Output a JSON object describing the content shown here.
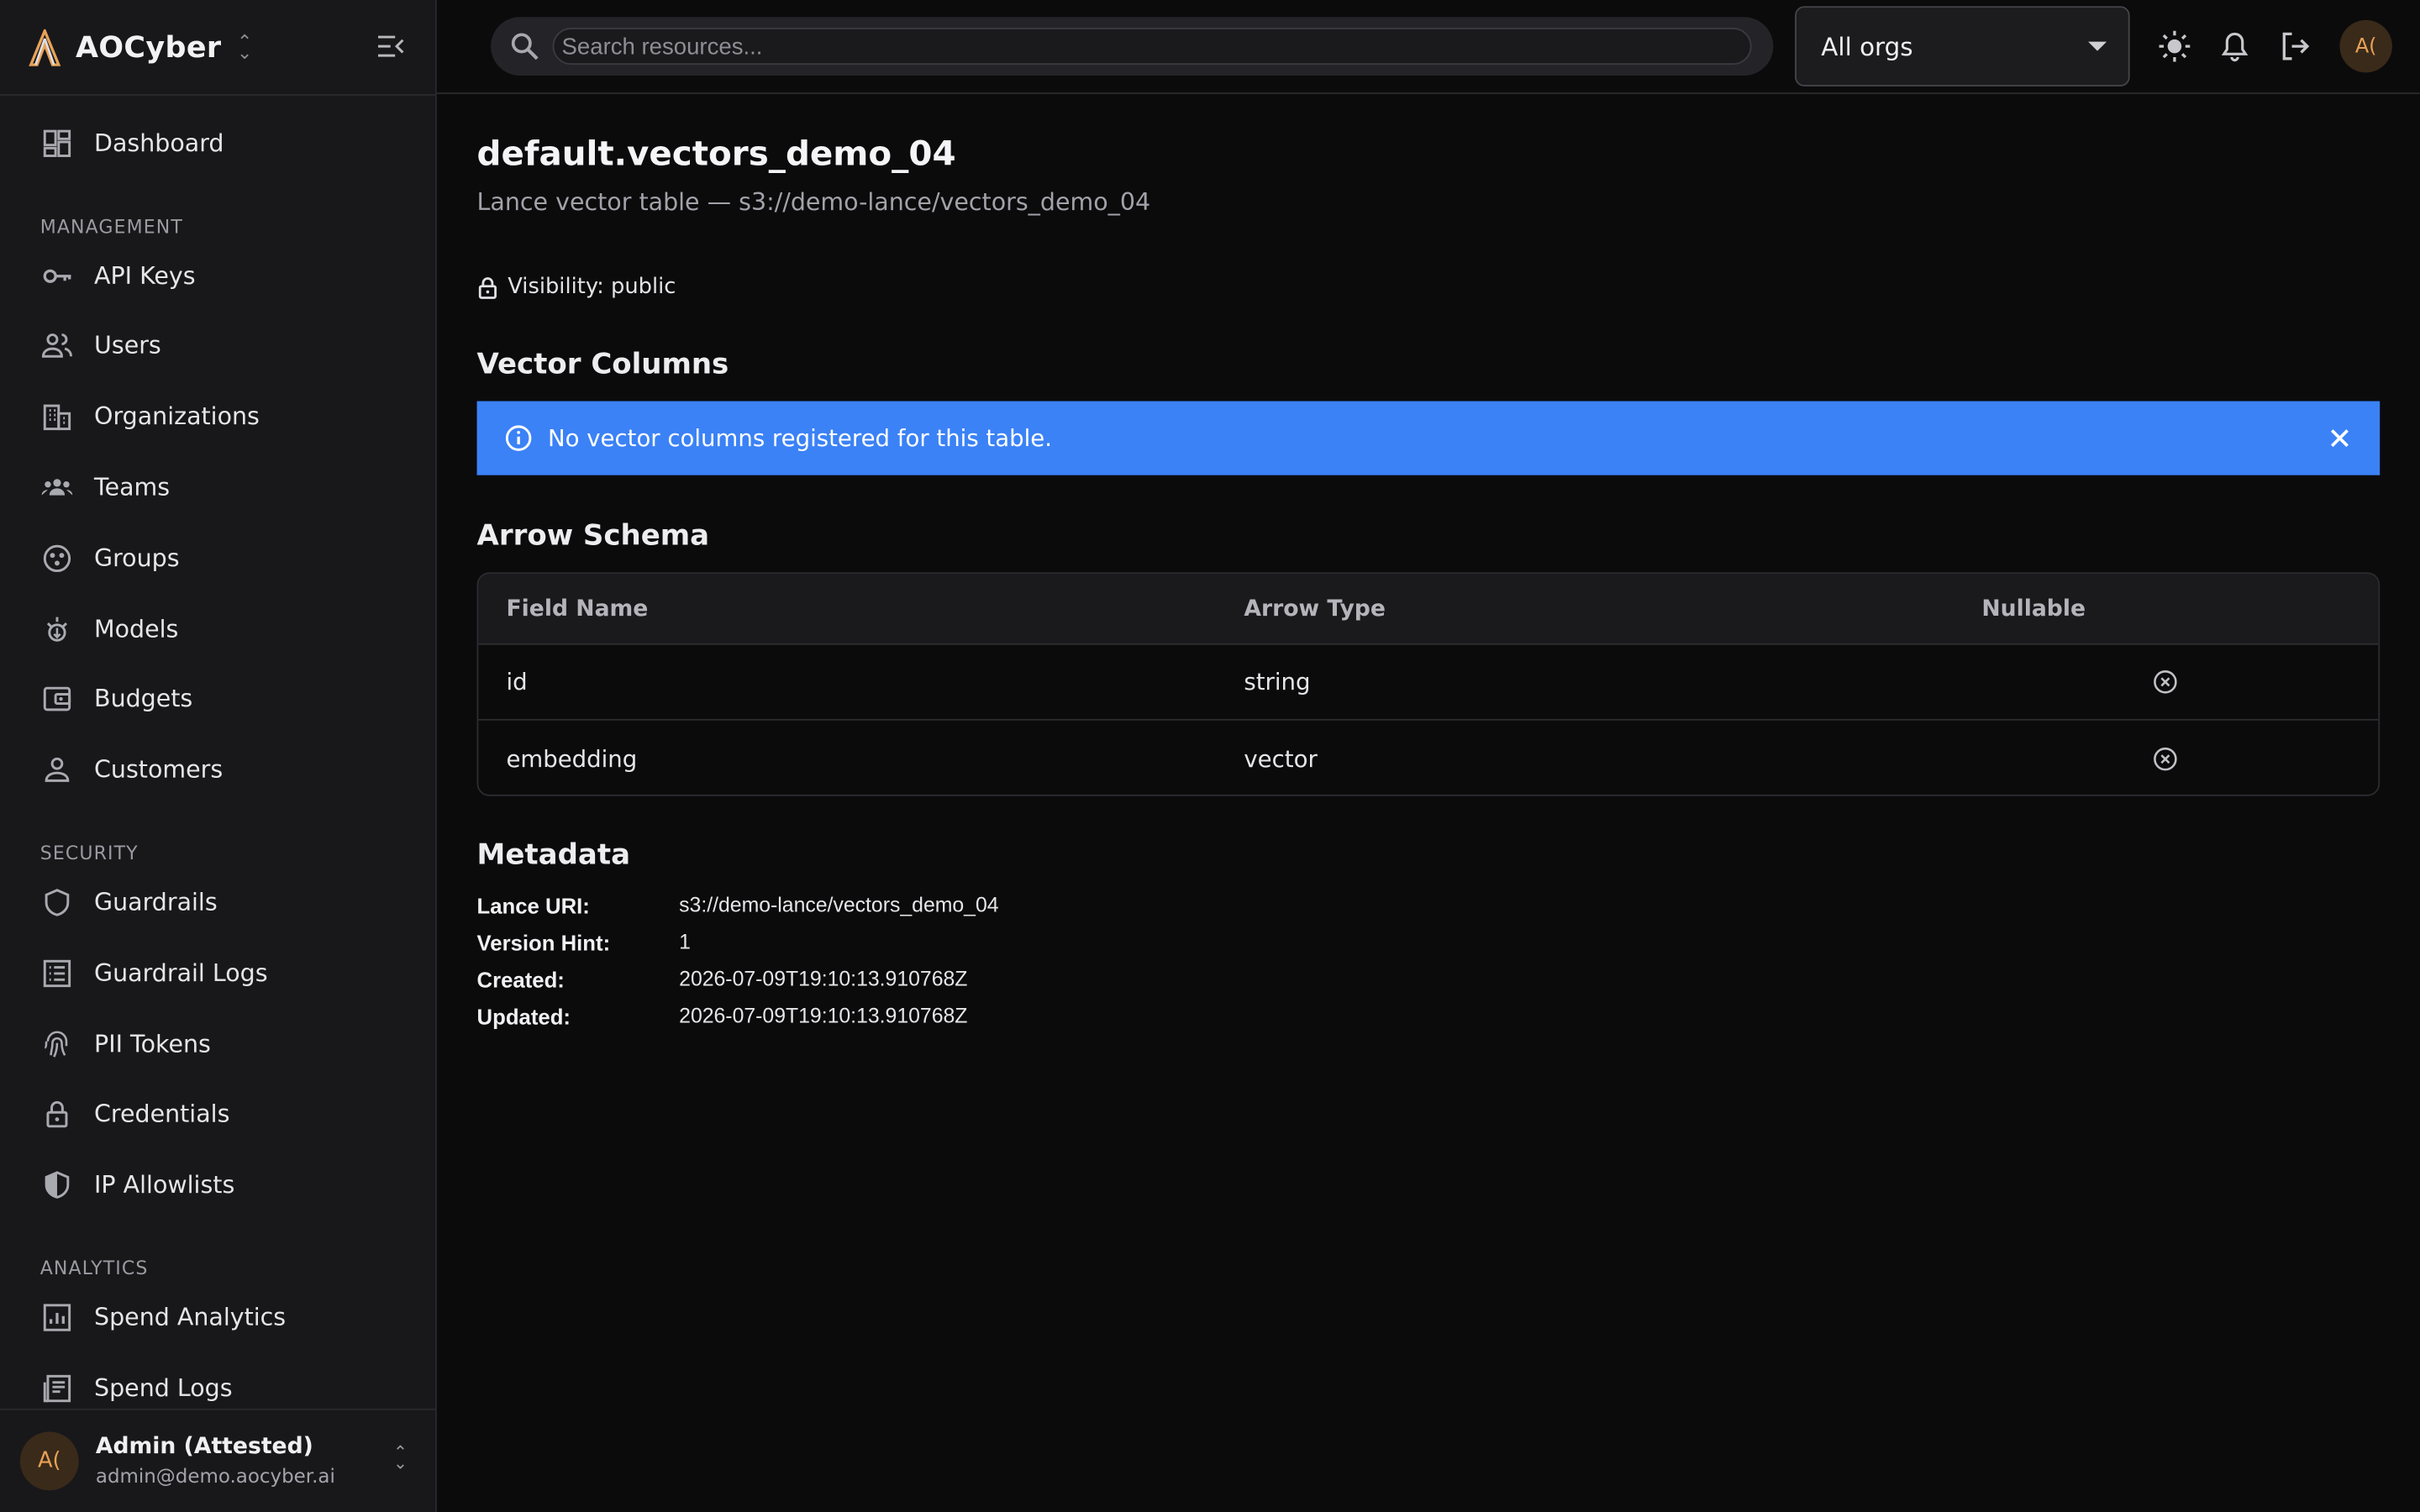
{
  "app": {
    "name": "AOCyber"
  },
  "sidebar": {
    "top_items": [
      {
        "label": "Dashboard",
        "icon": "dashboard-icon"
      }
    ],
    "sections": [
      {
        "title": "MANAGEMENT",
        "items": [
          {
            "label": "API Keys",
            "icon": "key-icon"
          },
          {
            "label": "Users",
            "icon": "users-icon"
          },
          {
            "label": "Organizations",
            "icon": "building-icon"
          },
          {
            "label": "Teams",
            "icon": "teams-icon"
          },
          {
            "label": "Groups",
            "icon": "groups-icon"
          },
          {
            "label": "Models",
            "icon": "model-icon"
          },
          {
            "label": "Budgets",
            "icon": "wallet-icon"
          },
          {
            "label": "Customers",
            "icon": "person-icon"
          }
        ]
      },
      {
        "title": "SECURITY",
        "items": [
          {
            "label": "Guardrails",
            "icon": "shield-icon"
          },
          {
            "label": "Guardrail Logs",
            "icon": "list-icon"
          },
          {
            "label": "PII Tokens",
            "icon": "fingerprint-icon"
          },
          {
            "label": "Credentials",
            "icon": "lock-icon"
          },
          {
            "label": "IP Allowlists",
            "icon": "shield-half-icon"
          }
        ]
      },
      {
        "title": "ANALYTICS",
        "items": [
          {
            "label": "Spend Analytics",
            "icon": "chart-icon"
          },
          {
            "label": "Spend Logs",
            "icon": "receipt-icon"
          }
        ]
      }
    ],
    "user": {
      "initials": "A(",
      "name": "Admin (Attested)",
      "email": "admin@demo.aocyber.ai"
    }
  },
  "topbar": {
    "search_placeholder": "Search resources...",
    "org_select": "All orgs",
    "avatar_initials": "A("
  },
  "page": {
    "title": "default.vectors_demo_04",
    "subtitle": "Lance vector table — s3://demo-lance/vectors_demo_04",
    "visibility": "Visibility: public",
    "vector_columns_heading": "Vector Columns",
    "alert_text": "No vector columns registered for this table.",
    "schema_heading": "Arrow Schema",
    "schema_columns": [
      "Field Name",
      "Arrow Type",
      "Nullable"
    ],
    "schema_rows": [
      {
        "field": "id",
        "type": "string",
        "nullable": "x-circle-icon"
      },
      {
        "field": "embedding",
        "type": "vector",
        "nullable": "x-circle-icon"
      }
    ],
    "metadata_heading": "Metadata",
    "metadata": [
      {
        "key": "Lance URI:",
        "value": "s3://demo-lance/vectors_demo_04"
      },
      {
        "key": "Version Hint:",
        "value": "1"
      },
      {
        "key": "Created:",
        "value": "2026-07-09T19:10:13.910768Z"
      },
      {
        "key": "Updated:",
        "value": "2026-07-09T19:10:13.910768Z"
      }
    ]
  },
  "colors": {
    "accent": "#3b82f6",
    "avatar_text": "#e8a256",
    "background": "#0b0b0c",
    "sidebar": "#18181b"
  }
}
